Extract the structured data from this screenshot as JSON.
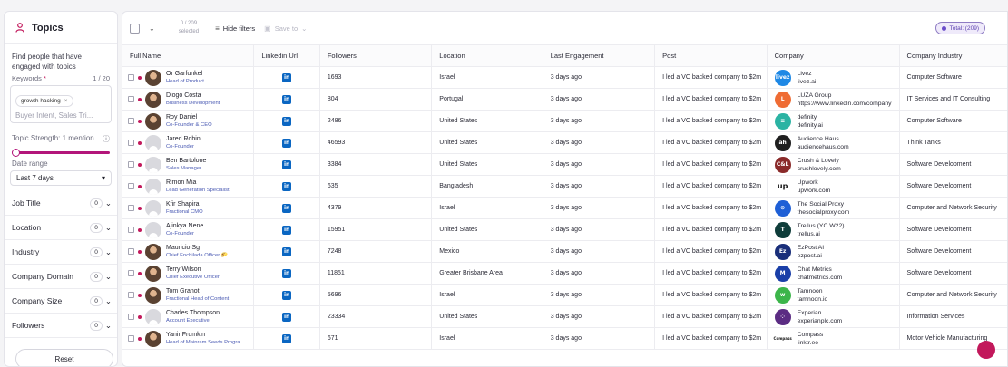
{
  "sidebar": {
    "title": "Topics",
    "description": "Find people that have engaged with topics",
    "keywords_label": "Keywords",
    "keywords_required": "*",
    "keywords_count": "1 / 20",
    "chip": "growth hacking",
    "keywords_placeholder": "Buyer Intent, Sales Tri...",
    "strength_label": "Topic Strength: 1 mention",
    "date_label": "Date range",
    "date_value": "Last 7 days",
    "filters": [
      {
        "label": "Job Title",
        "count": "0"
      },
      {
        "label": "Location",
        "count": "0"
      },
      {
        "label": "Industry",
        "count": "0"
      },
      {
        "label": "Company Domain",
        "count": "0"
      },
      {
        "label": "Company Size",
        "count": "0"
      },
      {
        "label": "Followers",
        "count": "0"
      }
    ],
    "reset_label": "Reset"
  },
  "toolbar": {
    "selected_count": "0 / 209",
    "selected_label": "selected",
    "hide_filters": "Hide filters",
    "save_to": "Save to",
    "total": "Total: (209)"
  },
  "columns": [
    "Full Name",
    "Linkedin Url",
    "Followers",
    "Location",
    "Last Engagement",
    "Post",
    "Company",
    "Company Industry"
  ],
  "rows": [
    {
      "name": "Or Garfunkel",
      "title": "Head of Product",
      "avatar": "photo",
      "followers": "1693",
      "location": "Israel",
      "engagement": "3 days ago",
      "post": "I led a VC backed company to $2m",
      "company": "Livez",
      "domain": "livez.ai",
      "industry": "Computer Software",
      "logo": "livez",
      "logo_color": "#1e88e5"
    },
    {
      "name": "Diogo Costa",
      "title": "Business Development",
      "avatar": "photo",
      "followers": "804",
      "location": "Portugal",
      "engagement": "3 days ago",
      "post": "I led a VC backed company to $2m",
      "company": "LUZA Group",
      "domain": "https://www.linkedin.com/company",
      "industry": "IT Services and IT Consulting",
      "logo": "L",
      "logo_color": "#ef6c34"
    },
    {
      "name": "Roy Daniel",
      "title": "Co-Founder & CEO",
      "avatar": "photo",
      "followers": "2486",
      "location": "United States",
      "engagement": "3 days ago",
      "post": "I led a VC backed company to $2m",
      "company": "definity",
      "domain": "definity.ai",
      "industry": "Computer Software",
      "logo": "≡",
      "logo_color": "#2bb3a3"
    },
    {
      "name": "Jared Robin",
      "title": "Co-Founder",
      "avatar": "gray",
      "followers": "46593",
      "location": "United States",
      "engagement": "3 days ago",
      "post": "I led a VC backed company to $2m",
      "company": "Audience Haus",
      "domain": "audiencehaus.com",
      "industry": "Think Tanks",
      "logo": "ah",
      "logo_color": "#1f1f1f"
    },
    {
      "name": "Ben Bartolone",
      "title": "Sales Manager",
      "avatar": "gray",
      "followers": "3384",
      "location": "United States",
      "engagement": "3 days ago",
      "post": "I led a VC backed company to $2m",
      "company": "Crush & Lovely",
      "domain": "crushlovely.com",
      "industry": "Software Development",
      "logo": "C&L",
      "logo_color": "#8a2a2a"
    },
    {
      "name": "Rimon Mia",
      "title": "Lead Generation Specialist",
      "avatar": "gray",
      "followers": "635",
      "location": "Bangladesh",
      "engagement": "3 days ago",
      "post": "I led a VC backed company to $2m",
      "company": "Upwork",
      "domain": "upwork.com",
      "industry": "Software Development",
      "logo": "up",
      "logo_color": "#ffffff"
    },
    {
      "name": "Kfir Shapira",
      "title": "Fractional CMO",
      "avatar": "gray",
      "followers": "4379",
      "location": "Israel",
      "engagement": "3 days ago",
      "post": "I led a VC backed company to $2m",
      "company": "The Social Proxy",
      "domain": "thesocialproxy.com",
      "industry": "Computer and Network Security",
      "logo": "⊙",
      "logo_color": "#1e5fd6"
    },
    {
      "name": "Ajinkya Nene",
      "title": "Co-Founder",
      "avatar": "gray",
      "followers": "15951",
      "location": "United States",
      "engagement": "3 days ago",
      "post": "I led a VC backed company to $2m",
      "company": "Trellus (YC W22)",
      "domain": "trellus.ai",
      "industry": "Software Development",
      "logo": "T",
      "logo_color": "#0f3d3a"
    },
    {
      "name": "Mauricio Sg",
      "title": "Chief Enchilada Officer 🌮",
      "avatar": "photo",
      "followers": "7248",
      "location": "Mexico",
      "engagement": "3 days ago",
      "post": "I led a VC backed company to $2m",
      "company": "EzPost AI",
      "domain": "ezpost.ai",
      "industry": "Software Development",
      "logo": "Ez",
      "logo_color": "#1a2f7a"
    },
    {
      "name": "Terry Wilson",
      "title": "Chief Executive Officer",
      "avatar": "photo",
      "followers": "11851",
      "location": "Greater Brisbane Area",
      "engagement": "3 days ago",
      "post": "I led a VC backed company to $2m",
      "company": "Chat Metrics",
      "domain": "chatmetrics.com",
      "industry": "Software Development",
      "logo": "M",
      "logo_color": "#1a3fa8"
    },
    {
      "name": "Tom Granot",
      "title": "Fractional Head of Content",
      "avatar": "photo",
      "followers": "5696",
      "location": "Israel",
      "engagement": "3 days ago",
      "post": "I led a VC backed company to $2m",
      "company": "Tamnoon",
      "domain": "tamnoon.io",
      "industry": "Computer and Network Security",
      "logo": "w",
      "logo_color": "#3cb54a"
    },
    {
      "name": "Charles Thompson",
      "title": "Account Executive",
      "avatar": "gray",
      "followers": "23334",
      "location": "United States",
      "engagement": "3 days ago",
      "post": "I led a VC backed company to $2m",
      "company": "Experian",
      "domain": "experianplc.com",
      "industry": "Information Services",
      "logo": "⁘",
      "logo_color": "#5b2c83"
    },
    {
      "name": "Yanir Frumkin",
      "title": "Head of Mainram Seeds Progra",
      "avatar": "photo",
      "followers": "671",
      "location": "Israel",
      "engagement": "3 days ago",
      "post": "I led a VC backed company to $2m",
      "company": "Compass",
      "domain": "linktr.ee",
      "industry": "Motor Vehicle Manufacturing",
      "logo": "Compass",
      "logo_color": "#ffffff"
    }
  ],
  "colors": {
    "accent": "#c2185b",
    "linkedin": "#0a66c2",
    "total_badge": "#6a4cc9"
  }
}
